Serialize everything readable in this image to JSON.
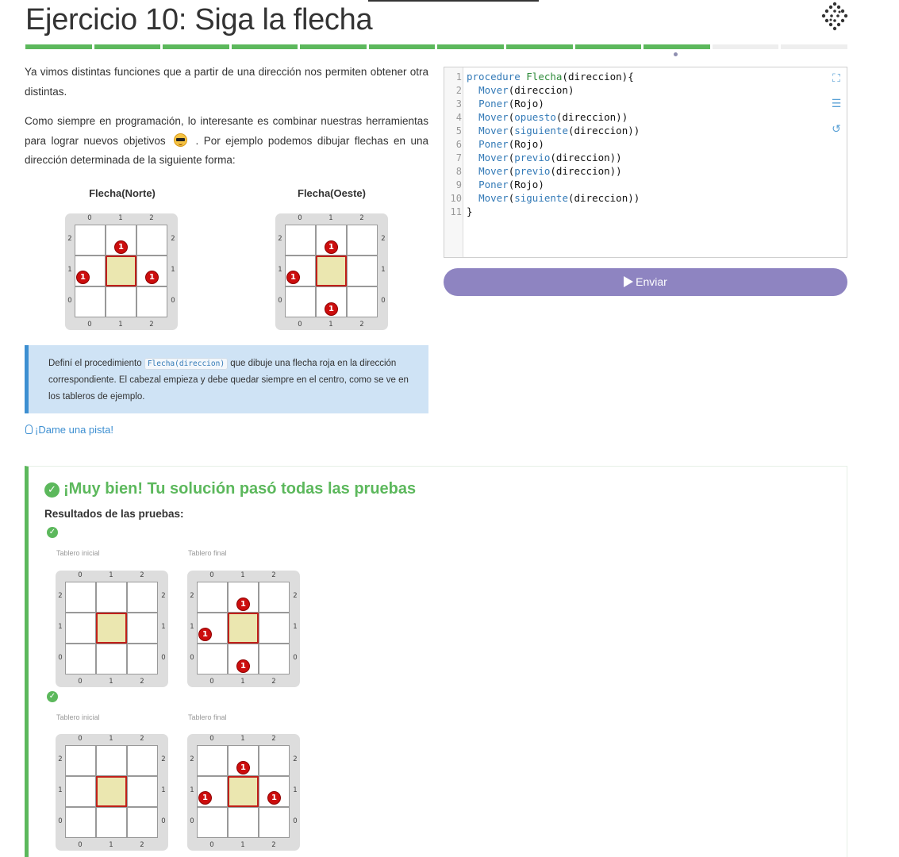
{
  "header": {
    "title": "Ejercicio 10: Siga la flecha",
    "progress_total": 12,
    "progress_done": 10
  },
  "description": {
    "p1": "Ya vimos distintas funciones que a partir de una dirección nos permiten obtener otra distintas.",
    "p2_before": "Como siempre en programación, lo interesante es combinar nuestras herramientas para lograr nuevos objetivos",
    "p2_emoji": "sunglasses-emoji",
    "p2_after": ". Por ejemplo podemos dibujar flechas en una dirección determinada de la siguiente forma:"
  },
  "examples": [
    {
      "caption": "Flecha(Norte)",
      "stones": [
        [
          1,
          2
        ],
        [
          0,
          1
        ],
        [
          2,
          1
        ]
      ]
    },
    {
      "caption": "Flecha(Oeste)",
      "stones": [
        [
          1,
          2
        ],
        [
          0,
          1
        ],
        [
          1,
          0
        ]
      ]
    }
  ],
  "board_labels": {
    "cols": [
      "0",
      "1",
      "2"
    ],
    "rows": [
      "2",
      "1",
      "0"
    ]
  },
  "stone_label": "1",
  "task": {
    "before": "Definí el procedimiento",
    "code": "Flecha(direccion)",
    "after": "que dibuje una flecha roja en la dirección correspondiente. El cabezal empieza y debe quedar siempre en el centro, como se ve en los tableros de ejemplo."
  },
  "hint": {
    "label": "¡Dame una pista!"
  },
  "editor": {
    "tools": [
      "fullscreen-icon",
      "indent-icon",
      "reset-icon"
    ],
    "lines": [
      "procedure Flecha(direccion){",
      "  Mover(direccion)",
      "  Poner(Rojo)",
      "  Mover(opuesto(direccion))",
      "  Mover(siguiente(direccion))",
      "  Poner(Rojo)",
      "  Mover(previo(direccion))",
      "  Mover(previo(direccion))",
      "  Poner(Rojo)",
      "  Mover(siguiente(direccion))",
      "}"
    ]
  },
  "submit": {
    "label": "Enviar"
  },
  "results": {
    "title": "¡Muy bien! Tu solución pasó todas las pruebas",
    "label": "Resultados de las pruebas:",
    "initial_label": "Tablero inicial",
    "final_label": "Tablero final",
    "tests": [
      {
        "initial_stones": [],
        "final_stones": [
          [
            1,
            2
          ],
          [
            0,
            1
          ],
          [
            1,
            0
          ]
        ]
      },
      {
        "initial_stones": [],
        "final_stones": [
          [
            1,
            2
          ],
          [
            0,
            1
          ],
          [
            2,
            1
          ]
        ]
      }
    ]
  },
  "colors": {
    "success": "#5cb85c",
    "accent": "#3d8fd1",
    "submit": "#8e84c1",
    "head": "#c0201a",
    "stone": "#cc0d0d"
  }
}
